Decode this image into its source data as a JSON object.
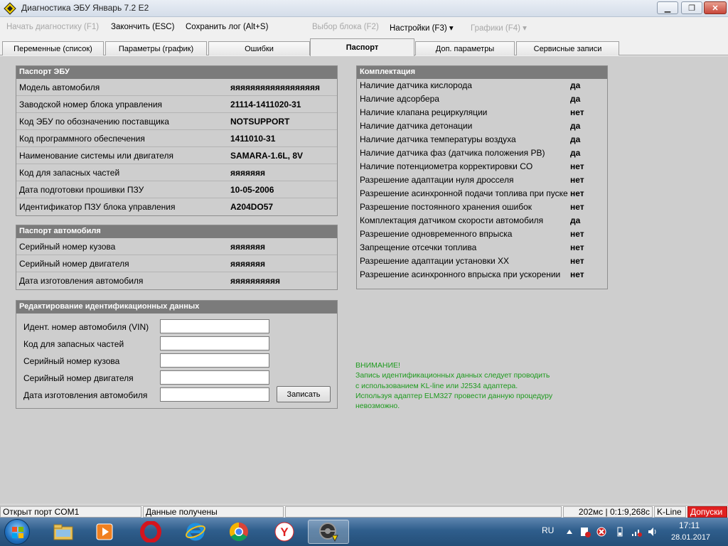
{
  "window": {
    "title": "Диагностика ЭБУ Январь 7.2 E2"
  },
  "menu": [
    {
      "label": "Начать диагностику (F1)",
      "disabled": true
    },
    {
      "label": "Закончить (ESC)",
      "disabled": false
    },
    {
      "label": "Сохранить лог (Alt+S)",
      "disabled": false
    },
    {
      "label": "Выбор блока (F2)",
      "disabled": true
    },
    {
      "label": "Настройки (F3) ▾",
      "disabled": false
    },
    {
      "label": "Графики (F4) ▾",
      "disabled": true
    }
  ],
  "tabs": [
    {
      "label": "Переменные (список)"
    },
    {
      "label": "Параметры (график)"
    },
    {
      "label": "Ошибки"
    },
    {
      "label": "Паспорт",
      "active": true
    },
    {
      "label": "Доп. параметры"
    },
    {
      "label": "Сервисные записи"
    }
  ],
  "ecu_passport": {
    "title": "Паспорт ЭБУ",
    "rows": [
      {
        "label": "Модель автомобиля",
        "value": "яяяяяяяяяяяяяяяяяя"
      },
      {
        "label": "Заводской номер блока управления",
        "value": "21114-1411020-31"
      },
      {
        "label": "Код ЭБУ по обозначению поставщика",
        "value": "NOTSUPPORT"
      },
      {
        "label": "Код программного обеспечения",
        "value": "1411010-31"
      },
      {
        "label": "Наименование системы или двигателя",
        "value": "SAMARA-1.6L, 8V"
      },
      {
        "label": "Код для запасных частей",
        "value": "яяяяяяя"
      },
      {
        "label": "Дата подготовки прошивки ПЗУ",
        "value": "10-05-2006"
      },
      {
        "label": "Идентификатор ПЗУ блока управления",
        "value": "A204DO57"
      }
    ]
  },
  "car_passport": {
    "title": "Паспорт автомобиля",
    "rows": [
      {
        "label": "Серийный номер кузова",
        "value": "яяяяяяя"
      },
      {
        "label": "Серийный номер двигателя",
        "value": "яяяяяяя"
      },
      {
        "label": "Дата изготовления автомобиля",
        "value": "яяяяяяяяяя"
      }
    ]
  },
  "edit_ids": {
    "title": "Редактирование идентификационных данных",
    "fields": [
      {
        "label": "Идент. номер автомобиля (VIN)",
        "value": ""
      },
      {
        "label": "Код для запасных частей",
        "value": ""
      },
      {
        "label": "Серийный номер кузова",
        "value": ""
      },
      {
        "label": "Серийный номер двигателя",
        "value": ""
      },
      {
        "label": "Дата изготовления автомобиля",
        "value": ""
      }
    ],
    "button_label": "Записать"
  },
  "equipment": {
    "title": "Комплектация",
    "rows": [
      {
        "label": "Наличие датчика кислорода",
        "value": "да"
      },
      {
        "label": "Наличие адсорбера",
        "value": "да"
      },
      {
        "label": "Наличие клапана рециркуляции",
        "value": "нет"
      },
      {
        "label": "Наличие датчика детонации",
        "value": "да"
      },
      {
        "label": "Наличие датчика температуры воздуха",
        "value": "да"
      },
      {
        "label": "Наличие датчика фаз (датчика положения РВ)",
        "value": "да"
      },
      {
        "label": "Наличие потенциометра корректировки CO",
        "value": "нет"
      },
      {
        "label": "Разрешение адаптации нуля дросселя",
        "value": "нет"
      },
      {
        "label": "Разрешение асинхронной подачи топлива при пуске",
        "value": "нет"
      },
      {
        "label": "Разрешение постоянного хранения ошибок",
        "value": "нет"
      },
      {
        "label": "Комплектация датчиком скорости автомобиля",
        "value": "да"
      },
      {
        "label": "Разрешение одновременного впрыска",
        "value": "нет"
      },
      {
        "label": "Запрещение отсечки топлива",
        "value": "нет"
      },
      {
        "label": "Разрешение адаптации установки ХХ",
        "value": "нет"
      },
      {
        "label": "Разрешение асинхронного впрыска при ускорении",
        "value": "нет"
      }
    ]
  },
  "warning": {
    "lines": [
      "ВНИМАНИЕ!",
      "Запись идентификационных данных следует проводить",
      "с использованием KL-line или J2534 адаптера.",
      "Используя адаптер ELM327 провести данную процедуру",
      "невозможно."
    ],
    "color": "#1e9a1e"
  },
  "status_bar": {
    "port": "Открыт порт COM1",
    "data_status": "Данные получены",
    "timing": "202мс | 0:1:9,268с",
    "protocol": "K-Line",
    "tolerance": "Допуски",
    "tolerance_color": "#e02020"
  },
  "taskbar": {
    "apps": [
      "explorer-icon",
      "media-player-icon",
      "opera-icon",
      "internet-explorer-icon",
      "chrome-icon",
      "yandex-icon",
      "ecu-diagnostic-icon"
    ],
    "language": "RU",
    "time": "17:11",
    "date": "28.01.2017"
  }
}
